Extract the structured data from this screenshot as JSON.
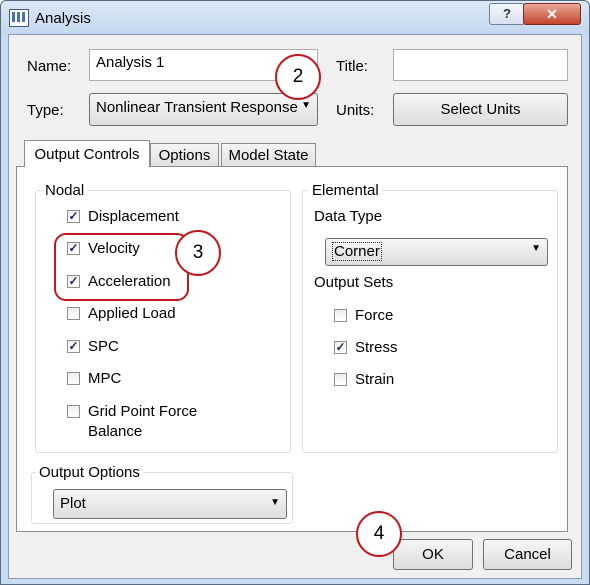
{
  "window": {
    "title": "Analysis",
    "help": "?",
    "close": "✕"
  },
  "form": {
    "name_label": "Name:",
    "name_value": "Analysis 1",
    "title_label": "Title:",
    "title_value": "",
    "type_label": "Type:",
    "type_value": "Nonlinear Transient Response",
    "units_label": "Units:",
    "units_button": "Select Units"
  },
  "tabs": [
    "Output Controls",
    "Options",
    "Model State"
  ],
  "nodal": {
    "title": "Nodal",
    "items": [
      {
        "label": "Displacement",
        "checked": true
      },
      {
        "label": "Velocity",
        "checked": true
      },
      {
        "label": "Acceleration",
        "checked": true
      },
      {
        "label": "Applied Load",
        "checked": false
      },
      {
        "label": "SPC",
        "checked": true
      },
      {
        "label": "MPC",
        "checked": false
      },
      {
        "label": "Grid Point Force",
        "label2": "Balance",
        "checked": false
      }
    ]
  },
  "elemental": {
    "title": "Elemental",
    "data_type_label": "Data Type",
    "data_type_value": "Corner",
    "output_sets_label": "Output Sets",
    "items": [
      {
        "label": "Force",
        "checked": false
      },
      {
        "label": "Stress",
        "checked": true
      },
      {
        "label": "Strain",
        "checked": false
      }
    ]
  },
  "output_options": {
    "title": "Output Options",
    "value": "Plot"
  },
  "buttons": {
    "ok": "OK",
    "cancel": "Cancel"
  },
  "callouts": [
    "2",
    "3",
    "4"
  ],
  "check_glyph": "✓",
  "colors": {
    "callout": "#c0181c",
    "titlebar": "#c4d7ef",
    "close": "#c5432b"
  }
}
